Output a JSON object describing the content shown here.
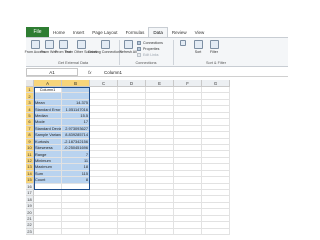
{
  "ribbon_tabs": [
    {
      "label": "File",
      "active": false
    },
    {
      "label": "Home",
      "active": false
    },
    {
      "label": "Insert",
      "active": false
    },
    {
      "label": "Page Layout",
      "active": false
    },
    {
      "label": "Formulas",
      "active": false
    },
    {
      "label": "Data",
      "active": true
    },
    {
      "label": "Review",
      "active": false
    },
    {
      "label": "View",
      "active": false
    }
  ],
  "ribbon": {
    "from_access": "From Access",
    "from_web": "From Web",
    "from_text": "From Text",
    "from_other_sources": "From Other Sources",
    "existing_connections": "Existing Connections",
    "refresh_all": "Refresh All",
    "connections": "Connections",
    "properties": "Properties",
    "edit_links": "Edit Links",
    "sort": "Sort",
    "filter": "Filter",
    "group_get_external_data": "Get External Data",
    "group_connections": "Connections",
    "group_sort_filter": "Sort & Filter"
  },
  "formula_bar": {
    "name_box": "A1",
    "fx": "fx",
    "content": "Column1"
  },
  "columns": [
    "A",
    "B",
    "C",
    "D",
    "E",
    "F",
    "G"
  ],
  "selected_columns": [
    "A",
    "B"
  ],
  "rows": [
    {
      "n": "1",
      "a": "Column1",
      "b": "",
      "header": true
    },
    {
      "n": "2",
      "a": "",
      "b": ""
    },
    {
      "n": "3",
      "a": "Mean",
      "b": "14.375"
    },
    {
      "n": "4",
      "a": "Standard Error",
      "b": "1.051147016"
    },
    {
      "n": "5",
      "a": "Median",
      "b": "15.5"
    },
    {
      "n": "6",
      "a": "Mode",
      "b": "17"
    },
    {
      "n": "7",
      "a": "Standard Deviation",
      "b": "2.973093627"
    },
    {
      "n": "8",
      "a": "Sample Variance",
      "b": "8.839285714"
    },
    {
      "n": "9",
      "a": "Kurtosis",
      "b": "-2.187342156"
    },
    {
      "n": "10",
      "a": "Skewness",
      "b": "-0.250451696"
    },
    {
      "n": "11",
      "a": "Range",
      "b": "7"
    },
    {
      "n": "12",
      "a": "Minimum",
      "b": "11"
    },
    {
      "n": "13",
      "a": "Maximum",
      "b": "18"
    },
    {
      "n": "14",
      "a": "Sum",
      "b": "115"
    },
    {
      "n": "15",
      "a": "Count",
      "b": "8"
    },
    {
      "n": "16",
      "a": "",
      "b": ""
    },
    {
      "n": "17",
      "a": "",
      "b": ""
    },
    {
      "n": "18",
      "a": "",
      "b": ""
    },
    {
      "n": "19",
      "a": "",
      "b": ""
    },
    {
      "n": "20",
      "a": "",
      "b": ""
    },
    {
      "n": "21",
      "a": "",
      "b": ""
    },
    {
      "n": "22",
      "a": "",
      "b": ""
    },
    {
      "n": "23",
      "a": "",
      "b": ""
    }
  ],
  "colors": {
    "file_tab": "#2e7d32",
    "selection_fill": "#b9d3ef",
    "header_highlight": "#f7d57a"
  }
}
